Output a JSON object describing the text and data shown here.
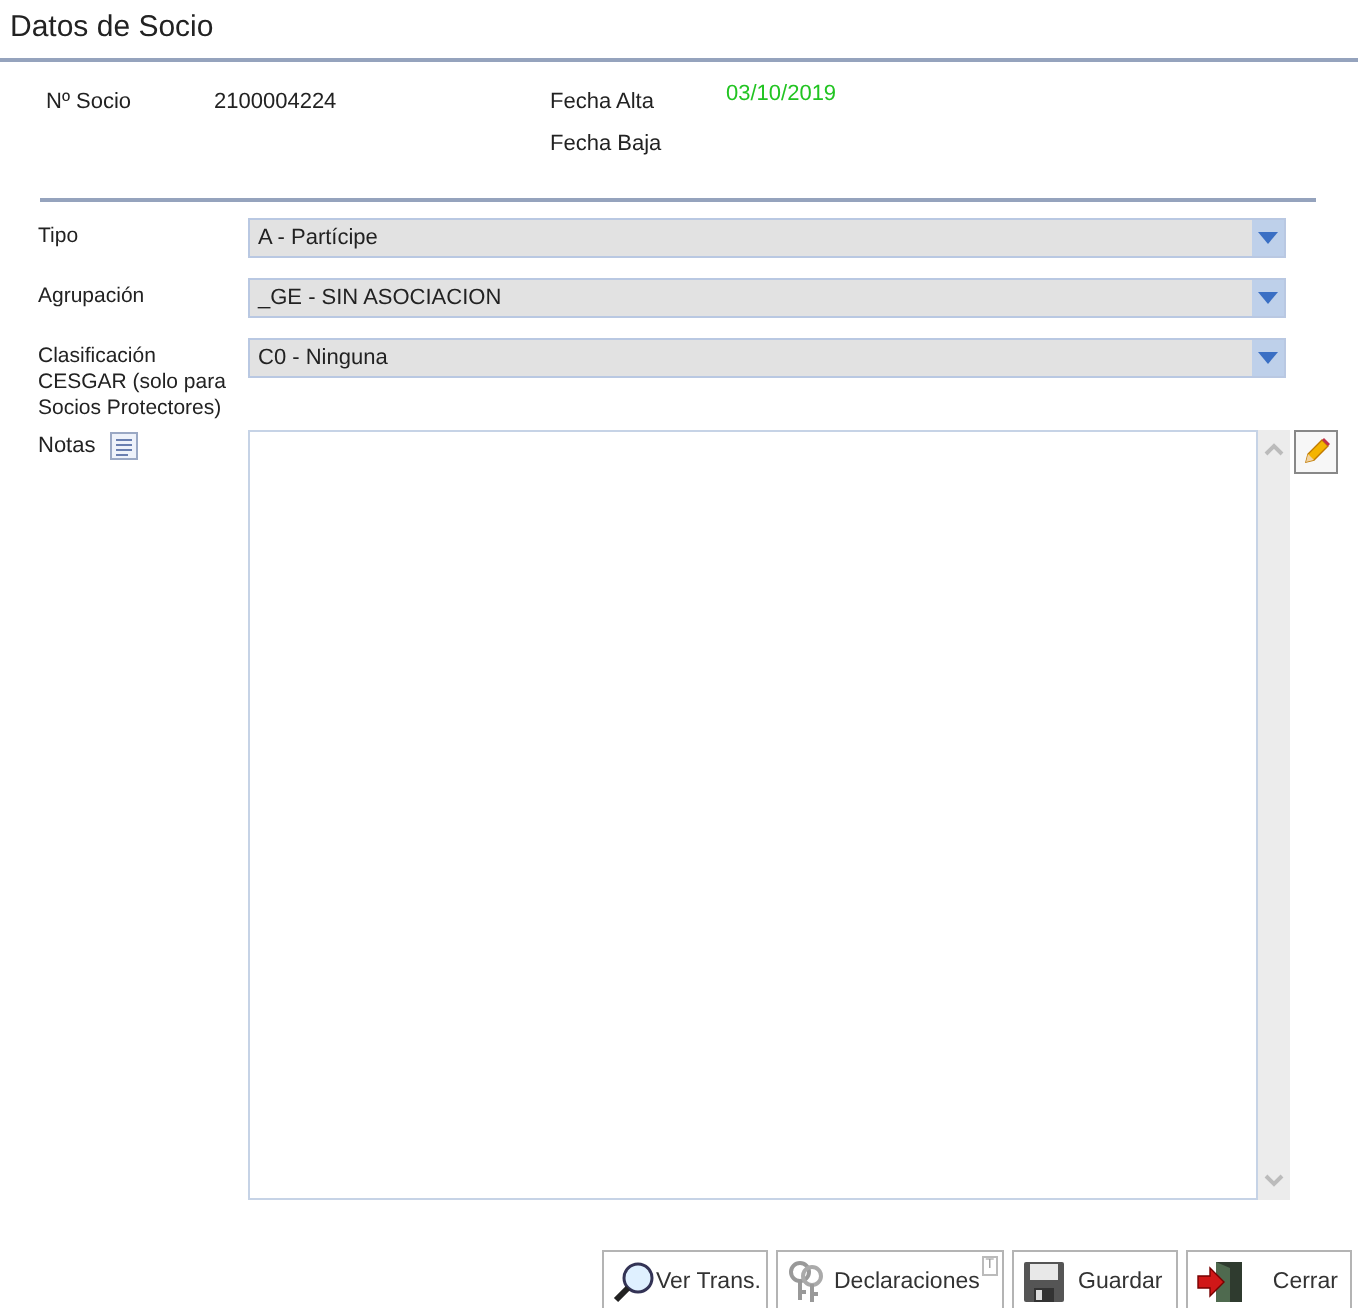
{
  "window": {
    "title": "Datos de Socio"
  },
  "info": {
    "socio_label": "Nº Socio",
    "socio_value": "2100004224",
    "alta_label": "Fecha Alta",
    "alta_value": "03/10/2019",
    "baja_label": "Fecha Baja"
  },
  "fields": [
    {
      "label": "Tipo",
      "value": "A - Partícipe"
    },
    {
      "label": "Agrupación",
      "value": "_GE - SIN ASOCIACION"
    },
    {
      "label": "Clasificación CESGAR (solo para Socios Protectores)",
      "value": "C0 - Ninguna"
    }
  ],
  "notes": {
    "label": "Notas"
  },
  "buttons": [
    {
      "kind": "search",
      "label": "Ver Trans."
    },
    {
      "kind": "keys",
      "label": "Declaraciones",
      "badge": "T"
    },
    {
      "kind": "save",
      "label": "Guardar"
    },
    {
      "kind": "exit",
      "label": "Cerrar"
    }
  ]
}
